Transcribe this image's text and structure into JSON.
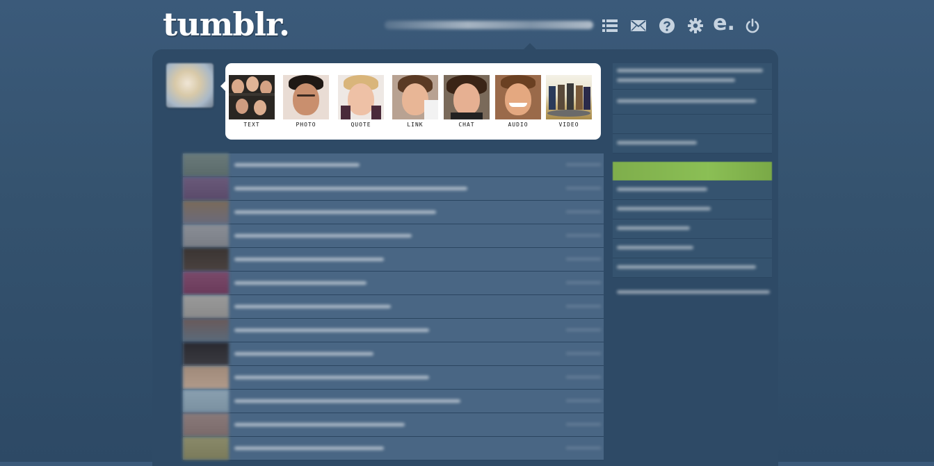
{
  "header": {
    "logo": "tumblr.",
    "nav_icons": [
      "dashboard-list-icon",
      "mail-icon",
      "help-icon",
      "gear-icon",
      "e-icon",
      "power-icon"
    ]
  },
  "post_chooser": {
    "types": [
      {
        "label": "TEXT",
        "icon": "text-post-photo"
      },
      {
        "label": "PHOTO",
        "icon": "photo-post-photo"
      },
      {
        "label": "QUOTE",
        "icon": "quote-post-photo"
      },
      {
        "label": "LINK",
        "icon": "link-post-photo"
      },
      {
        "label": "CHAT",
        "icon": "chat-post-photo"
      },
      {
        "label": "AUDIO",
        "icon": "audio-post-photo"
      },
      {
        "label": "VIDEO",
        "icon": "video-post-photo"
      }
    ]
  },
  "colors": {
    "background": "#3b5a7a",
    "container": "#2e4a66",
    "row": "#496684",
    "accent_green": "#8bbf55"
  }
}
